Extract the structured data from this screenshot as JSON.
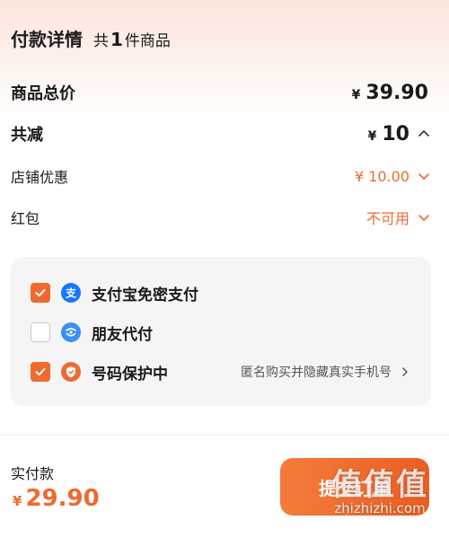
{
  "header": {
    "title": "付款详情",
    "count_prefix": "共",
    "count": "1",
    "count_suffix": "件商品"
  },
  "summary": {
    "total_label": "商品总价",
    "total_currency": "¥",
    "total_value": "39.90",
    "discount_label": "共减",
    "discount_currency": "¥",
    "discount_value": "10"
  },
  "store_coupon": {
    "label": "店铺优惠",
    "value": "¥ 10.00"
  },
  "red_packet": {
    "label": "红包",
    "value": "不可用"
  },
  "options": [
    {
      "label": "支付宝免密支付",
      "checked": true,
      "icon": "alipay-icon"
    },
    {
      "label": "朋友代付",
      "checked": false,
      "icon": "friend-pay-icon"
    },
    {
      "label": "号码保护中",
      "checked": true,
      "icon": "shield-icon",
      "extra": "匿名购买并隐藏真实手机号"
    }
  ],
  "footer": {
    "pay_label": "实付款",
    "pay_currency": "¥",
    "pay_value": "29.90",
    "submit_label": "提交订单"
  },
  "watermark": {
    "main": "值值值",
    "sub": "zhizhizhi.com"
  },
  "colors": {
    "accent": "#ee6a2f",
    "alipay": "#1677ff",
    "card_bg": "#f5f5f6"
  }
}
